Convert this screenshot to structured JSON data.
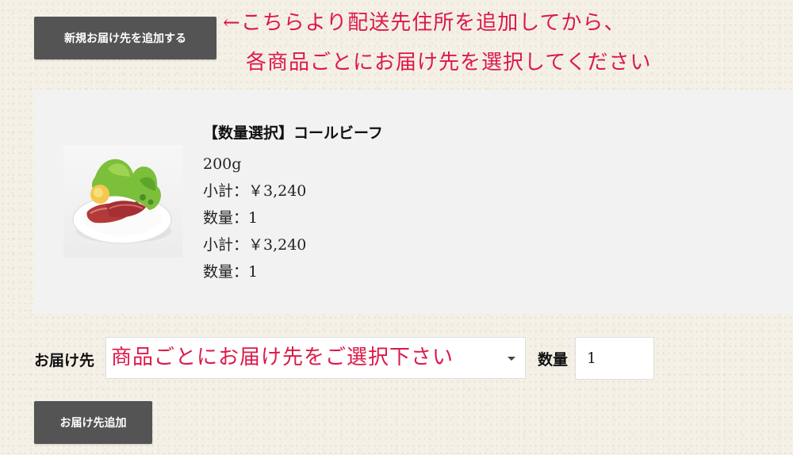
{
  "buttons": {
    "add_new_address": "新規お届け先を追加する",
    "add_shipping": "お届け先追加"
  },
  "notice": {
    "line1": "←こちらより配送先住所を追加してから、",
    "line2": "各商品ごとにお届け先を選択してください",
    "color": "#dc1948"
  },
  "item": {
    "name": "【数量選択】コールビーフ",
    "image_alt": "コールビーフ",
    "details": [
      "200g",
      "小計：￥3,240",
      "数量：1",
      "小計：￥3,240",
      "数量：1"
    ]
  },
  "shipping": {
    "label": "お届け先",
    "select_value": "商品ごとにお届け先をご選択下さい",
    "qty_label": "数量",
    "qty_value": "1"
  },
  "colors": {
    "button_bg": "#545454",
    "card_bg": "#f2f2f2",
    "accent_red": "#dc1948"
  }
}
